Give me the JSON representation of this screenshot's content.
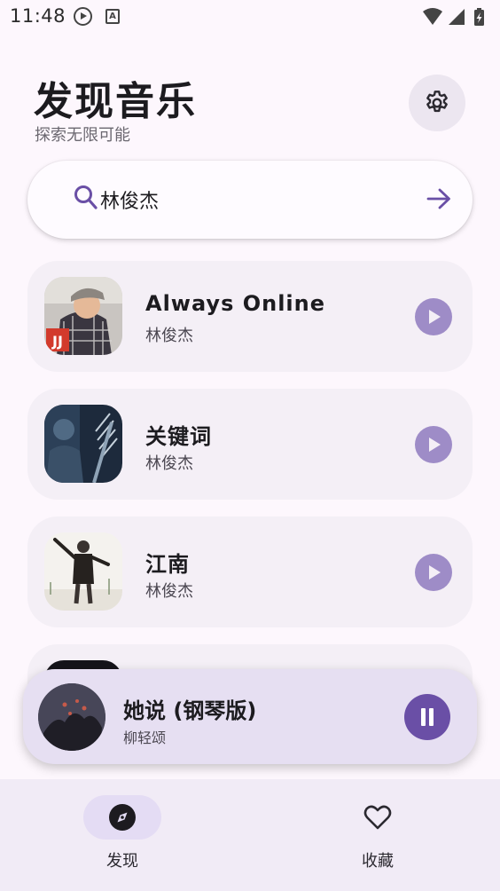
{
  "status_bar": {
    "time": "11:48",
    "a_label": "A"
  },
  "header": {
    "title": "发现音乐",
    "subtitle": "探索无限可能"
  },
  "search": {
    "value": "林俊杰"
  },
  "songs": [
    {
      "title": "Always Online",
      "artist": "林俊杰"
    },
    {
      "title": "关键词",
      "artist": "林俊杰"
    },
    {
      "title": "江南",
      "artist": "林俊杰"
    }
  ],
  "now_playing": {
    "title": "她说 (钢琴版)",
    "artist": "柳轻颂",
    "state": "playing"
  },
  "nav": {
    "items": [
      {
        "label": "发现",
        "icon": "compass-icon",
        "selected": true
      },
      {
        "label": "收藏",
        "icon": "heart-icon",
        "selected": false
      }
    ]
  },
  "colors": {
    "accent": "#6a4fa6",
    "play_button": "#9e8cc7",
    "card_bg": "#f4eff6",
    "background": "#fdf7fd"
  }
}
